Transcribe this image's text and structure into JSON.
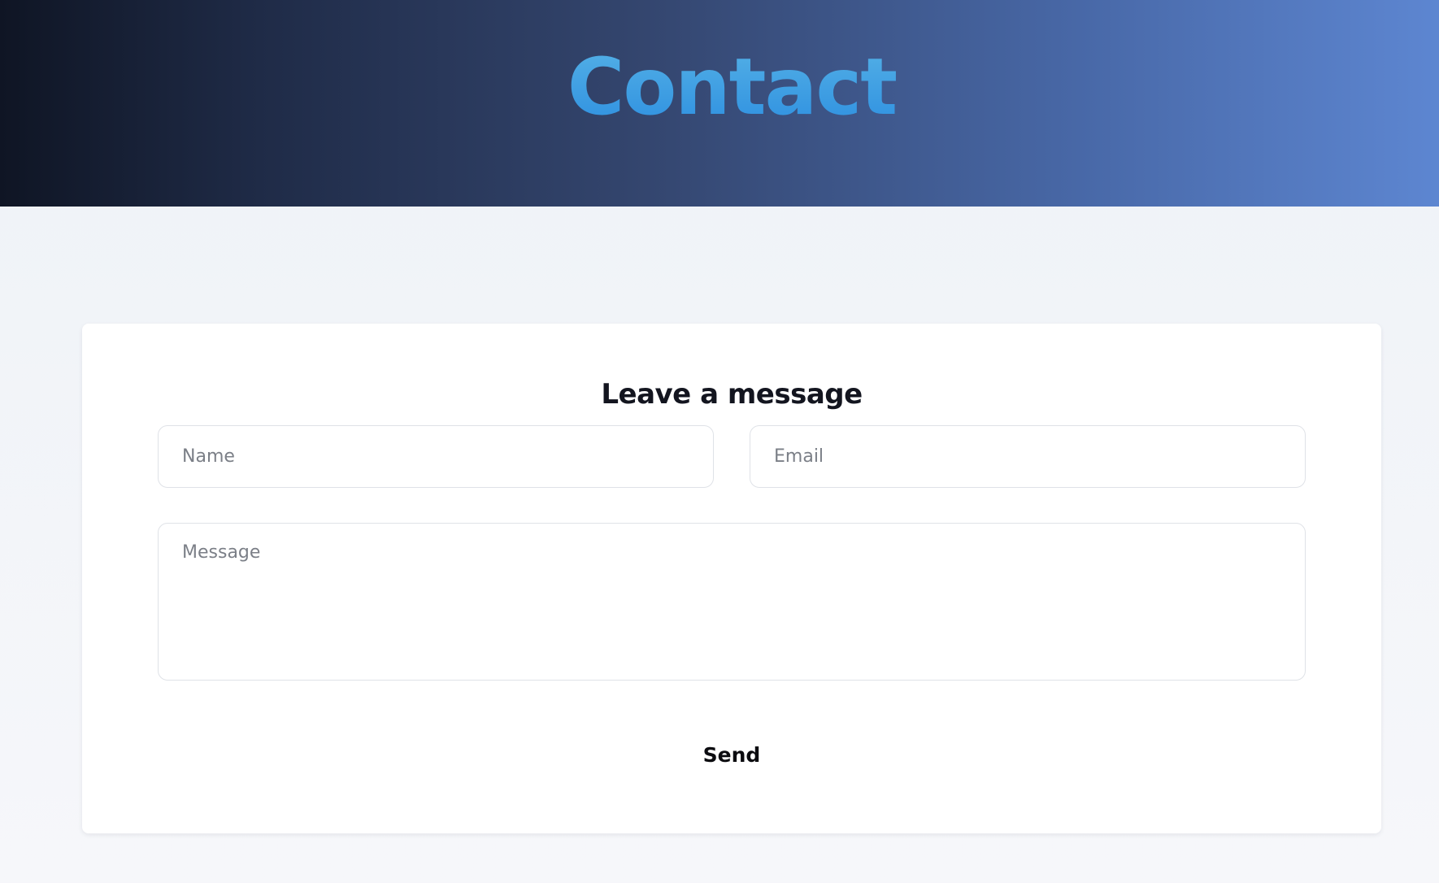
{
  "header": {
    "title": "Contact"
  },
  "form": {
    "title": "Leave a message",
    "name_placeholder": "Name",
    "email_placeholder": "Email",
    "message_placeholder": "Message",
    "send_label": "Send"
  },
  "colors": {
    "header_gradient_start": "#0f1524",
    "header_gradient_end": "#5d86d1",
    "title_gradient_top": "#55b1e6",
    "title_gradient_bottom": "#2d8fe0",
    "page_background": "#f1f4f8",
    "card_background": "#ffffff",
    "heading_text": "#13151f"
  }
}
